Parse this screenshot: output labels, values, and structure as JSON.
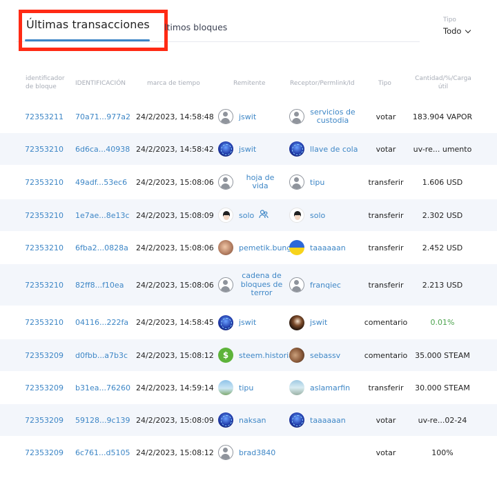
{
  "tabs": {
    "active": "Últimas transacciones",
    "inactive": "ltimos bloques"
  },
  "filter": {
    "label": "Tipo",
    "value": "Todo"
  },
  "columns": {
    "block_id_line1": "identificador",
    "block_id_line2": "de bloque",
    "id": "IDENTIFICACIÓN",
    "timestamp": "marca de tiempo",
    "sender": "Remitente",
    "receiver": "Receptor/Permlink/Id",
    "type": "Tipo",
    "amount_line1": "Cantidad/%/Carga",
    "amount_line2": "útil"
  },
  "rows": [
    {
      "block": "72353211",
      "id": "70a71...977a2",
      "time": "24/2/2023, 14:58:48",
      "sender": "jswit",
      "receiver_line1": "servicios de",
      "receiver_line2": "custodia",
      "type": "votar",
      "amount": "183.904 VAPOR"
    },
    {
      "block": "72353210",
      "id": "6d6ca...40938",
      "time": "24/2/2023, 14:58:42",
      "sender": "jswit",
      "receiver": "llave de cola",
      "type": "votar",
      "amount": "uv-re... umento"
    },
    {
      "block": "72353210",
      "id": "49adf...53ec6",
      "time": "24/2/2023, 15:08:06",
      "sender_line1": "hoja de",
      "sender_line2": "vida",
      "receiver": "tipu",
      "type": "transferir",
      "amount": "1.606 USD"
    },
    {
      "block": "72353210",
      "id": "1e7ae...8e13c",
      "time": "24/2/2023, 15:08:09",
      "sender": "solo",
      "receiver": "solo",
      "type": "transferir",
      "amount": "2.302 USD"
    },
    {
      "block": "72353210",
      "id": "6fba2...0828a",
      "time": "24/2/2023, 15:08:06",
      "sender": "pemetik.bung",
      "receiver": "taaaaaan",
      "type": "transferir",
      "amount": "2.452 USD"
    },
    {
      "block": "72353210",
      "id": "82ff8...f10ea",
      "time": "24/2/2023, 15:08:06",
      "sender_line1": "cadena de",
      "sender_line2": "bloques de",
      "sender_line3": "terror",
      "receiver": "franqiec",
      "type": "transferir",
      "amount": "2.213 USD"
    },
    {
      "block": "72353210",
      "id": "04116...222fa",
      "time": "24/2/2023, 14:58:45",
      "sender": "jswit",
      "receiver": "jswit",
      "type": "comentario",
      "amount": "0.01%"
    },
    {
      "block": "72353209",
      "id": "d0fbb...a7b3c",
      "time": "24/2/2023, 15:08:12",
      "sender": "steem.historia",
      "receiver": "sebassv",
      "type": "comentario",
      "amount": "35.000 STEAM"
    },
    {
      "block": "72353209",
      "id": "b31ea...76260",
      "time": "24/2/2023, 14:59:14",
      "sender": "tipu",
      "receiver": "aslamarfin",
      "type": "transferir",
      "amount": "30.000 STEAM"
    },
    {
      "block": "72353209",
      "id": "59128...9c139",
      "time": "24/2/2023, 15:08:09",
      "sender": "naksan",
      "receiver": "taaaaaan",
      "type": "votar",
      "amount": "uv-re...02-24"
    },
    {
      "block": "72353209",
      "id": "6c761...d5105",
      "time": "24/2/2023, 15:08:12",
      "sender": "brad3840",
      "type": "votar",
      "amount": "100%"
    }
  ],
  "icons": {
    "dollar_symbol": "$"
  }
}
